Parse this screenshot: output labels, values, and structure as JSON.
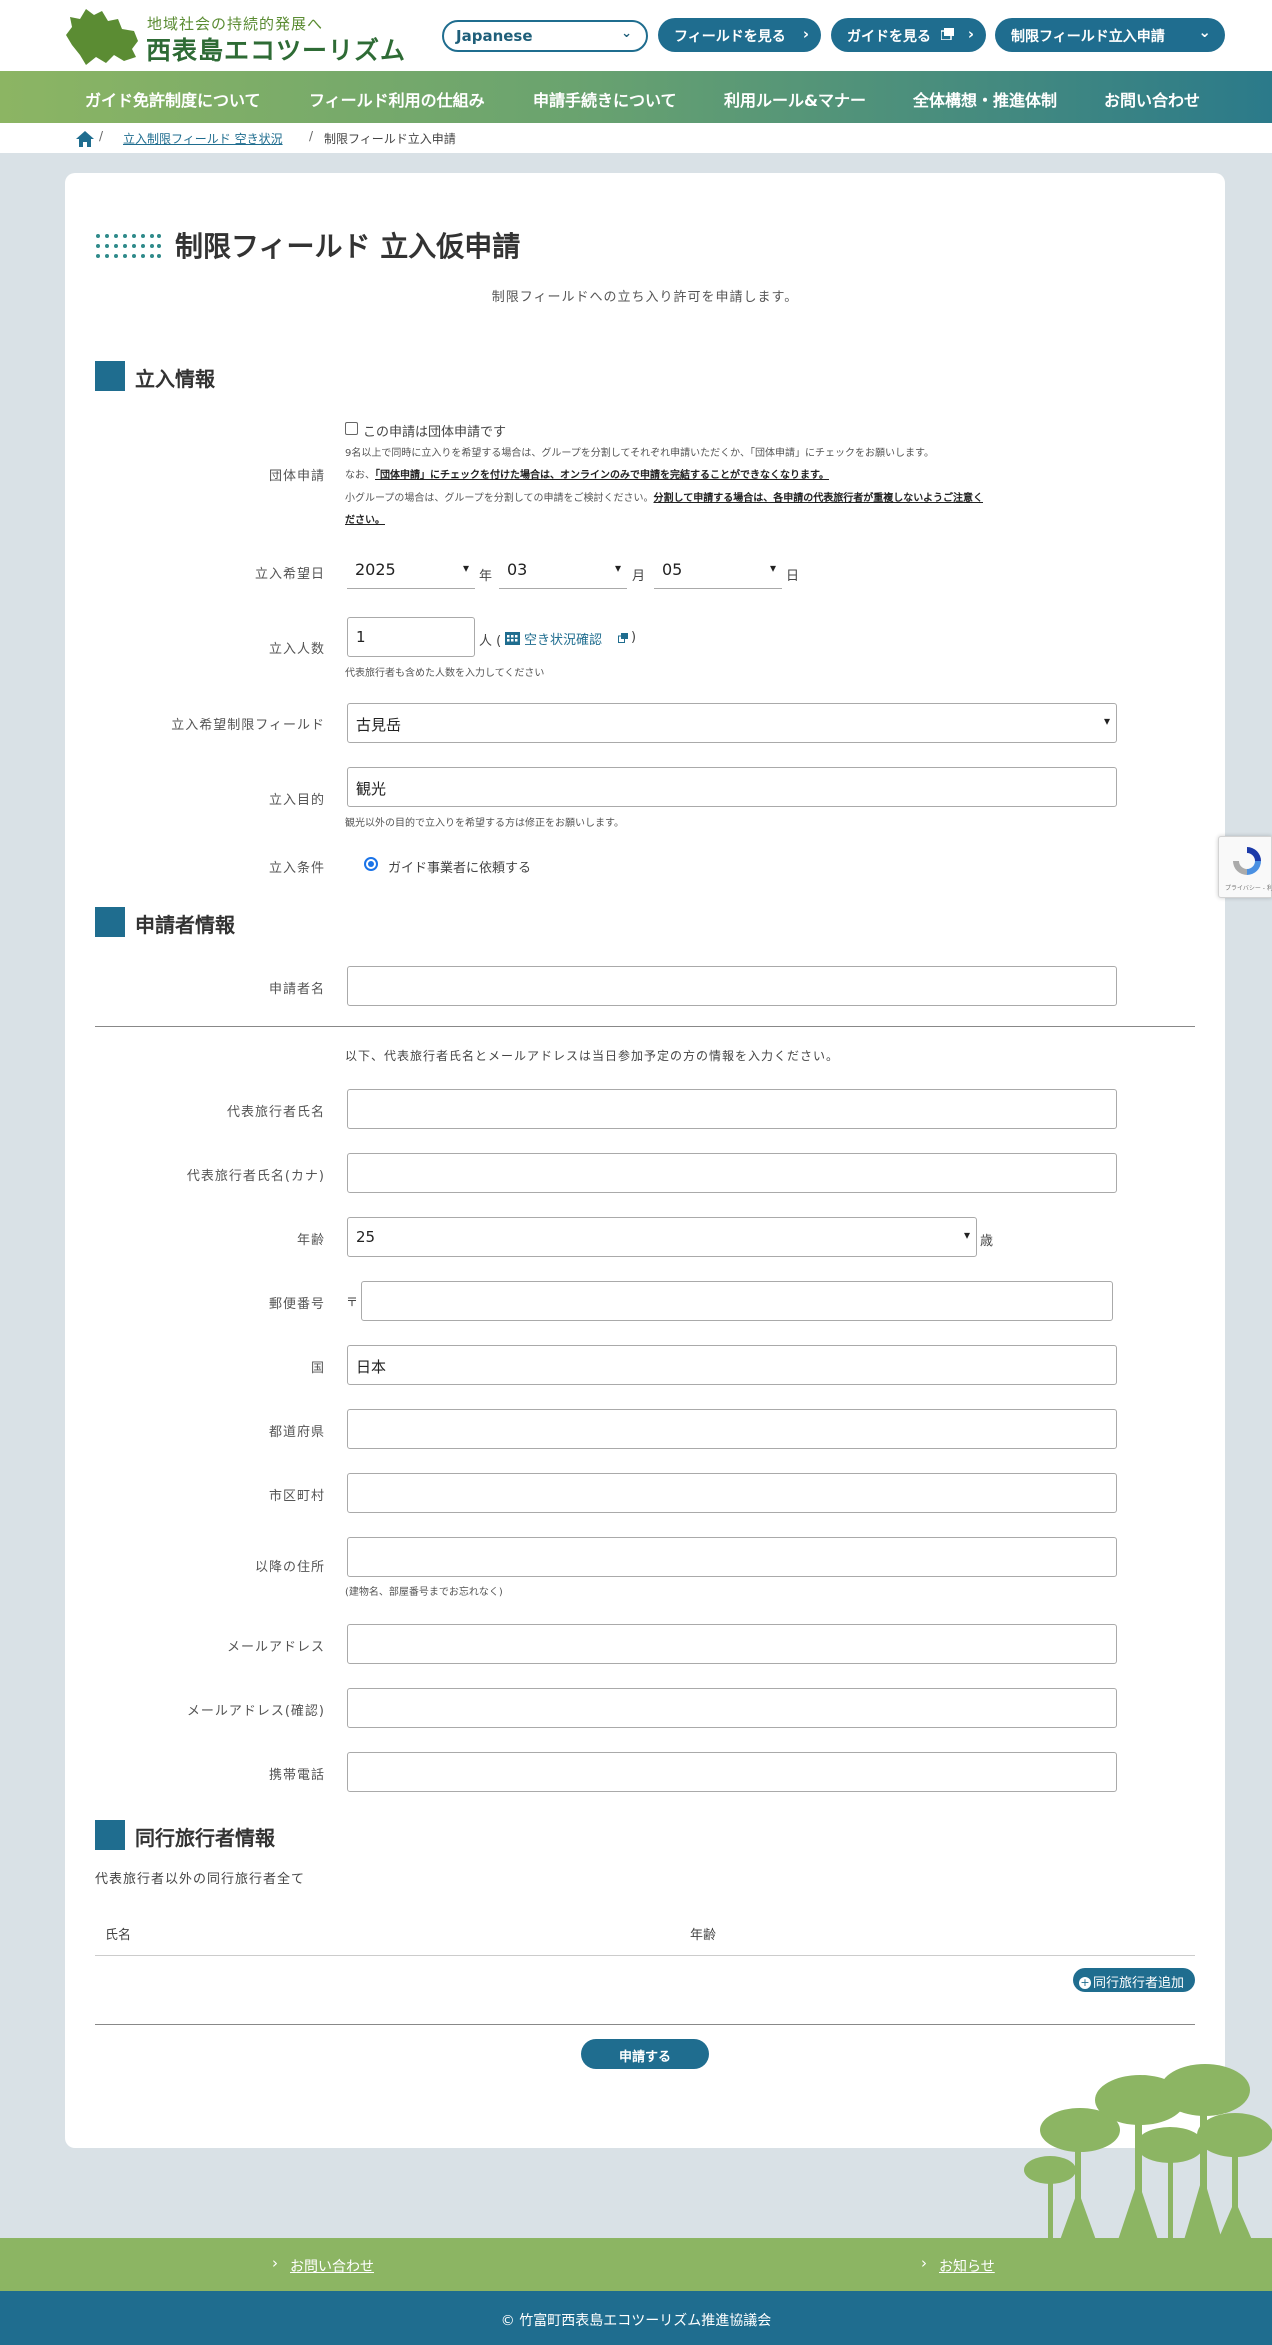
{
  "header": {
    "logo_sub": "地域社会の持続的発展へ",
    "logo_main": "西表島エコツーリズム",
    "language": "Japanese",
    "buttons": {
      "field": "フィールドを見る",
      "guide": "ガイドを見る",
      "apply": "制限フィールド立入申請"
    }
  },
  "nav": {
    "items": [
      "ガイド免許制度について",
      "フィールド利用の仕組み",
      "申請手続きについて",
      "利用ルール&マナー",
      "全体構想・推進体制",
      "お問い合わせ"
    ]
  },
  "breadcrumb": {
    "items": [
      "立入制限フィールド 空き状況",
      "制限フィールド立入申請"
    ]
  },
  "page": {
    "title": "制限フィールド 立入仮申請",
    "description": "制限フィールドへの立ち入り許可を申請します。"
  },
  "sections": {
    "entry": "立入情報",
    "applicant": "申請者情報",
    "companions": "同行旅行者情報"
  },
  "group": {
    "label": "団体申請",
    "checkbox_label": "この申請は団体申請です",
    "note1": "9名以上で同時に立入りを希望する場合は、グループを分割してそれぞれ申請いただくか、「団体申請」にチェックをお願いします。",
    "note2_prefix": "なお、",
    "note2_underlined": "「団体申請」にチェックを付けた場合は、オンラインのみで申請を完結することができなくなります。",
    "note3_prefix": "小グループの場合は、グループを分割しての申請をご検討ください。",
    "note3_underlined_a": "分割して申請する場合は、各申請の代表旅行者が重複しないようご注意く",
    "note3_underlined_b": "ださい。"
  },
  "date": {
    "label": "立入希望日",
    "year": "2025",
    "year_unit": "年",
    "month": "03",
    "month_unit": "月",
    "day": "05",
    "day_unit": "日"
  },
  "people": {
    "label": "立入人数",
    "value": "1",
    "unit": "人",
    "paren_open": "(",
    "availability_link": "空き状況確認",
    "paren_close": ")",
    "note": "代表旅行者も含めた人数を入力してください"
  },
  "field": {
    "label": "立入希望制限フィールド",
    "value": "古見岳"
  },
  "purpose": {
    "label": "立入目的",
    "value": "観光",
    "note": "観光以外の目的で立入りを希望する方は修正をお願いします。"
  },
  "condition": {
    "label": "立入条件",
    "option": "ガイド事業者に依頼する"
  },
  "applicant": {
    "name_label": "申請者名",
    "name_value": "",
    "info_note": "以下、代表旅行者氏名とメールアドレスは当日参加予定の方の情報を入力ください。",
    "rep_name_label": "代表旅行者氏名",
    "rep_kana_label": "代表旅行者氏名(カナ)",
    "age_label": "年齢",
    "age_value": "25",
    "age_unit": "歳",
    "postal_label": "郵便番号",
    "postal_mark": "〒",
    "country_label": "国",
    "country_value": "日本",
    "pref_label": "都道府県",
    "city_label": "市区町村",
    "address_label": "以降の住所",
    "address_note": "(建物名、部屋番号までお忘れなく)",
    "email_label": "メールアドレス",
    "email_confirm_label": "メールアドレス(確認)",
    "phone_label": "携帯電話"
  },
  "companions": {
    "description": "代表旅行者以外の同行旅行者全て",
    "col_name": "氏名",
    "col_age": "年齢",
    "add_button": "同行旅行者追加"
  },
  "submit": "申請する",
  "footer": {
    "contact": "お問い合わせ",
    "news": "お知らせ",
    "copyright": "© 竹富町西表島エコツーリズム推進協議会"
  },
  "recaptcha": {
    "text": "プライバシー - 利用規約"
  },
  "colors": {
    "primary": "#1f6d8f",
    "green": "#8cb563",
    "background": "#d9e1e6"
  }
}
